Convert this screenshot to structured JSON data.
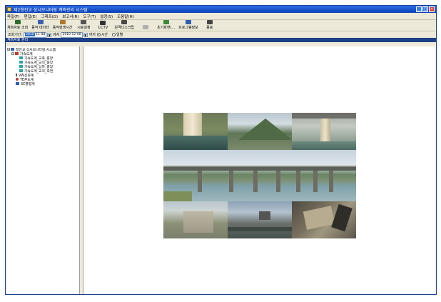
{
  "window": {
    "title": "제2청진교 상시모니터링 계측관리 시스템"
  },
  "menu": [
    "파일(F)",
    "편집(E)",
    "그래프(G)",
    "보고서(R)",
    "도구(T)",
    "설정(S)",
    "도움말(H)"
  ],
  "toolbar": [
    {
      "label": "계측자료 조회",
      "icon": "database-icon",
      "color": "#2e6b2e"
    },
    {
      "label": "동적 데이터",
      "icon": "chart-icon",
      "color": "#3a62b0"
    },
    {
      "label": "동적발생시간",
      "icon": "clock-icon",
      "color": "#b07a2e"
    },
    {
      "label": "시료설정",
      "icon": "settings-icon",
      "color": "#555555"
    },
    {
      "label": "CCTV",
      "icon": "camera-icon",
      "color": "#333333"
    },
    {
      "label": "원격디스크립",
      "icon": "remote-icon",
      "color": "#4a4a4a"
    },
    {
      "label": "",
      "icon": "disabled-icon",
      "color": "#b0b0b0",
      "disabled": true
    },
    {
      "label": "초기화면(...",
      "icon": "home-icon",
      "color": "#3a8a3a"
    },
    {
      "label": "프로그램정보",
      "icon": "info-icon",
      "color": "#2d5fb0"
    },
    {
      "label": "종료",
      "icon": "exit-icon",
      "color": "#444444"
    }
  ],
  "query": {
    "period_label": "조회기간:",
    "start_date": "2010-11-08",
    "start_selected": "2010",
    "start_rest": "-11-08",
    "to_label": "에서",
    "end_date": "2010-12-08",
    "end_suffix": "까지",
    "radio_time": "시간",
    "radio_day": "일별"
  },
  "panel": {
    "header": "계측자료 관리"
  },
  "tree": [
    {
      "label": "청진교 상시모니터링 시스템",
      "level": 0,
      "expander": "−",
      "icon_color": "#3a62b0"
    },
    {
      "label": "가속도계",
      "level": 1,
      "expander": "−",
      "icon_color": "#c0392b"
    },
    {
      "label": "가속도계_교축_중앙",
      "level": 2,
      "icon_color": "#2fa3a3"
    },
    {
      "label": "가속도계_교직_중앙",
      "level": 2,
      "icon_color": "#2fa3a3"
    },
    {
      "label": "가속도계_상하_중앙",
      "level": 2,
      "icon_color": "#2fa3a3"
    },
    {
      "label": "가속도계_교직_측면",
      "level": 2,
      "icon_color": "#2fa3a3"
    },
    {
      "label": "VW신축계",
      "level": 1,
      "expander": "+",
      "icon_color": "#555555"
    },
    {
      "label": "TE온도계",
      "level": 1,
      "expander": "+",
      "icon_color": "#c0392b"
    },
    {
      "label": "SC풍향계",
      "level": 1,
      "expander": "+",
      "icon_color": "#2d5fb0"
    }
  ]
}
